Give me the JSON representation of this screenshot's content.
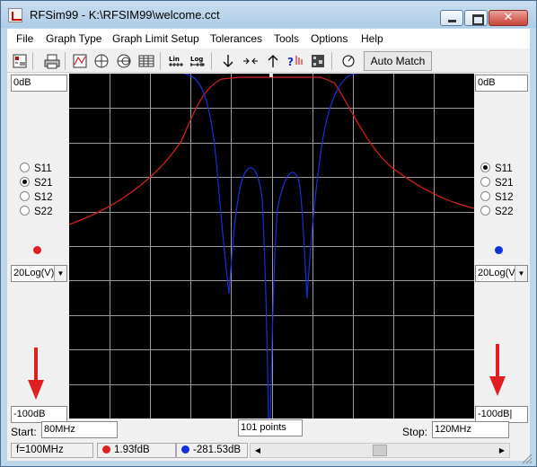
{
  "window": {
    "title": "RFSim99 - K:\\RFSIM99\\welcome.cct",
    "close_label": "✕"
  },
  "menu": [
    "File",
    "Graph Type",
    "Graph Limit Setup",
    "Tolerances",
    "Tools",
    "Options",
    "Help"
  ],
  "toolbar": {
    "icons": [
      "save-schematic-icon",
      "print-icon",
      "graph-icon",
      "polar-icon",
      "smith-chart-icon",
      "table-icon",
      "linear-scale-icon",
      "log-scale-icon",
      "down-arrow-icon",
      "zoom-in-icon",
      "up-arrow-icon",
      "help-icon",
      "component-icon",
      "tune-icon"
    ],
    "lin_label": "Lin",
    "log_label": "Log",
    "auto_match_label": "Auto Match"
  },
  "left_panel": {
    "top_value": "0dB",
    "bottom_value": "-100dB",
    "params": [
      {
        "label": "S11",
        "selected": false
      },
      {
        "label": "S21",
        "selected": true
      },
      {
        "label": "S12",
        "selected": false
      },
      {
        "label": "S22",
        "selected": false
      }
    ],
    "trace_color": "#e02020",
    "format": "20Log(V)"
  },
  "right_panel": {
    "top_value": "0dB",
    "bottom_value": "-100dB|",
    "params": [
      {
        "label": "S11",
        "selected": true
      },
      {
        "label": "S21",
        "selected": false
      },
      {
        "label": "S12",
        "selected": false
      },
      {
        "label": "S22",
        "selected": false
      }
    ],
    "trace_color": "#1030e0",
    "format": "20Log(V)"
  },
  "sweep": {
    "start_label": "Start:",
    "start_value": "80MHz",
    "points_value": "101 points",
    "stop_label": "Stop:",
    "stop_value": "120MHz"
  },
  "status": {
    "frequency": "f=100MHz",
    "left_readout": "1.93fdB",
    "right_readout": "-281.53dB",
    "scroll_position": 0.5
  },
  "colors": {
    "arrow": "#e02020",
    "grid": "#9a9a9a",
    "red_trace": "#e02020",
    "blue_trace": "#1a2fd6",
    "plot_bg": "#000000"
  }
}
